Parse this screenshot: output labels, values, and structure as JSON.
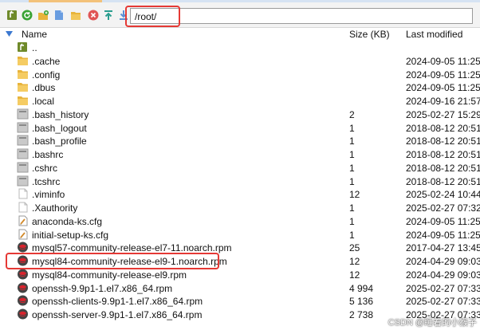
{
  "toolbar": {
    "path": "/root/",
    "buttons": [
      {
        "name": "parent-dir-icon",
        "color": "#8a6d1a"
      },
      {
        "name": "refresh-icon",
        "color": "#3aa335"
      },
      {
        "name": "new-folder-icon",
        "color": "#e0a12b"
      },
      {
        "name": "new-file-icon",
        "color": "#5b8fd6"
      },
      {
        "name": "open-folder-icon",
        "color": "#e0a12b"
      },
      {
        "name": "delete-icon",
        "color": "#e05555"
      },
      {
        "name": "upload-icon",
        "color": "#2a9d8f"
      },
      {
        "name": "download-icon",
        "color": "#2a7ad6"
      }
    ]
  },
  "columns": {
    "name": "Name",
    "size": "Size (KB)",
    "modified": "Last modified"
  },
  "files": [
    {
      "name": "..",
      "size": "",
      "modified": "",
      "icon": "parent"
    },
    {
      "name": ".cache",
      "size": "",
      "modified": "2024-09-05 11:25",
      "icon": "folder"
    },
    {
      "name": ".config",
      "size": "",
      "modified": "2024-09-05 11:25",
      "icon": "folder"
    },
    {
      "name": ".dbus",
      "size": "",
      "modified": "2024-09-05 11:25",
      "icon": "folder"
    },
    {
      "name": ".local",
      "size": "",
      "modified": "2024-09-16 21:57",
      "icon": "folder"
    },
    {
      "name": ".bash_history",
      "size": "2",
      "modified": "2025-02-27 15:29",
      "icon": "sysfile"
    },
    {
      "name": ".bash_logout",
      "size": "1",
      "modified": "2018-08-12 20:51",
      "icon": "sysfile"
    },
    {
      "name": ".bash_profile",
      "size": "1",
      "modified": "2018-08-12 20:51",
      "icon": "sysfile"
    },
    {
      "name": ".bashrc",
      "size": "1",
      "modified": "2018-08-12 20:51",
      "icon": "sysfile"
    },
    {
      "name": ".cshrc",
      "size": "1",
      "modified": "2018-08-12 20:51",
      "icon": "sysfile"
    },
    {
      "name": ".tcshrc",
      "size": "1",
      "modified": "2018-08-12 20:51",
      "icon": "sysfile"
    },
    {
      "name": ".viminfo",
      "size": "12",
      "modified": "2025-02-24 10:44",
      "icon": "blank"
    },
    {
      "name": ".Xauthority",
      "size": "1",
      "modified": "2025-02-27 07:32",
      "icon": "blank"
    },
    {
      "name": "anaconda-ks.cfg",
      "size": "1",
      "modified": "2024-09-05 11:25",
      "icon": "cfg"
    },
    {
      "name": "initial-setup-ks.cfg",
      "size": "1",
      "modified": "2024-09-05 11:25",
      "icon": "cfg"
    },
    {
      "name": "mysql57-community-release-el7-11.noarch.rpm",
      "size": "25",
      "modified": "2017-04-27 13:45",
      "icon": "rpm"
    },
    {
      "name": "mysql84-community-release-el9-1.noarch.rpm",
      "size": "12",
      "modified": "2024-04-29 09:03",
      "icon": "rpm"
    },
    {
      "name": "mysql84-community-release-el9.rpm",
      "size": "12",
      "modified": "2024-04-29 09:03",
      "icon": "rpm"
    },
    {
      "name": "openssh-9.9p1-1.el7.x86_64.rpm",
      "size": "4 994",
      "modified": "2025-02-27 07:33",
      "icon": "rpm"
    },
    {
      "name": "openssh-clients-9.9p1-1.el7.x86_64.rpm",
      "size": "5 136",
      "modified": "2025-02-27 07:33",
      "icon": "rpm"
    },
    {
      "name": "openssh-server-9.9p1-1.el7.x86_64.rpm",
      "size": "2 738",
      "modified": "2025-02-27 07:33",
      "icon": "rpm"
    }
  ],
  "watermark": "CSDN @睡着的小猴子"
}
